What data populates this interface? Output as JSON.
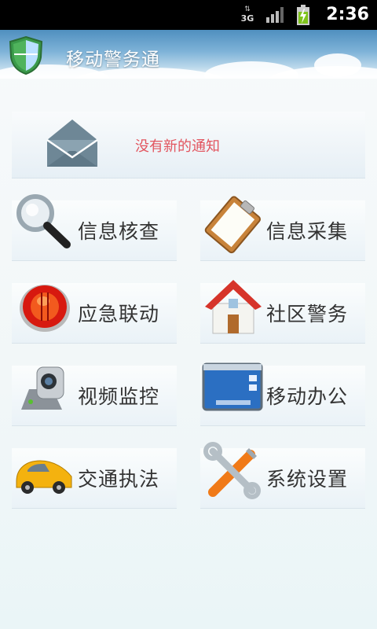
{
  "status_bar": {
    "time": "2:36",
    "network_label": "3G",
    "icons": [
      "network-3g-icon",
      "signal-icon",
      "battery-charging-icon"
    ]
  },
  "header": {
    "title": "移动警务通",
    "logo_icon": "police-shield-icon"
  },
  "notification": {
    "icon": "envelope-icon",
    "text": "没有新的通知",
    "text_color": "#e2555f"
  },
  "menu": [
    {
      "label": "信息核查",
      "icon": "magnifier-icon"
    },
    {
      "label": "信息采集",
      "icon": "clipboard-icon"
    },
    {
      "label": "应急联动",
      "icon": "alarm-light-icon"
    },
    {
      "label": "社区警务",
      "icon": "house-icon"
    },
    {
      "label": "视频监控",
      "icon": "webcam-icon"
    },
    {
      "label": "移动办公",
      "icon": "desktop-screen-icon"
    },
    {
      "label": "交通执法",
      "icon": "car-icon"
    },
    {
      "label": "系统设置",
      "icon": "tools-icon"
    }
  ]
}
